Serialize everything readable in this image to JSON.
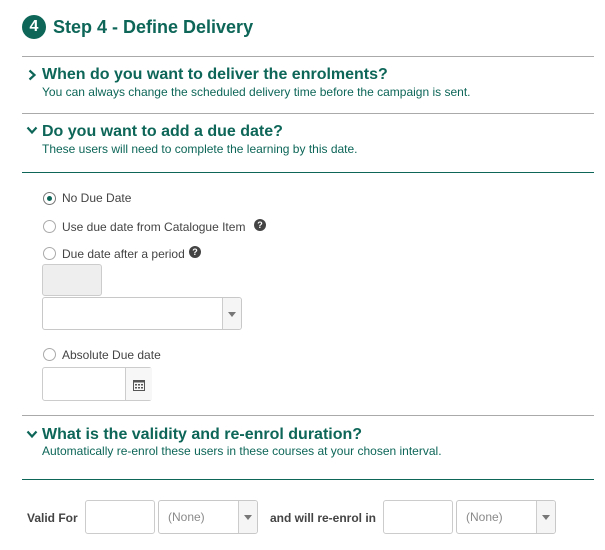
{
  "step": {
    "number": "4",
    "title": "Step 4 - Define Delivery"
  },
  "sections": {
    "delivery": {
      "title": "When do you want to deliver the enrolments?",
      "subtitle": "You can always change the scheduled delivery time before the campaign is sent.",
      "expanded": false
    },
    "due_date": {
      "title": "Do you want to add a due date?",
      "subtitle": "These users will need to complete the learning by this date.",
      "expanded": true,
      "options": [
        {
          "label": "No Due Date",
          "selected": true
        },
        {
          "label": "Use due date from Catalogue Item",
          "selected": false,
          "help": "?"
        },
        {
          "label": "Due date after a period",
          "selected": false,
          "help": "?"
        },
        {
          "label": "Absolute Due date",
          "selected": false
        }
      ],
      "period_value": "",
      "period_unit": "",
      "absolute_date": ""
    },
    "validity": {
      "title": "What is the validity and re-enrol duration?",
      "subtitle": "Automatically re-enrol these users in these courses at your chosen interval.",
      "expanded": true,
      "valid_for_label": "Valid For",
      "valid_for_value": "",
      "valid_for_unit": "(None)",
      "reenrol_label": "and will re-enrol in",
      "reenrol_value": "",
      "reenrol_unit": "(None)"
    }
  },
  "colors": {
    "accent": "#0d6658",
    "divider": "#aaaaaa"
  },
  "icons": {
    "chevron_collapsed": "chevron-right-icon",
    "chevron_expanded": "chevron-down-icon",
    "help": "question-circle-icon",
    "calendar": "calendar-icon",
    "dropdown": "caret-down-icon"
  }
}
